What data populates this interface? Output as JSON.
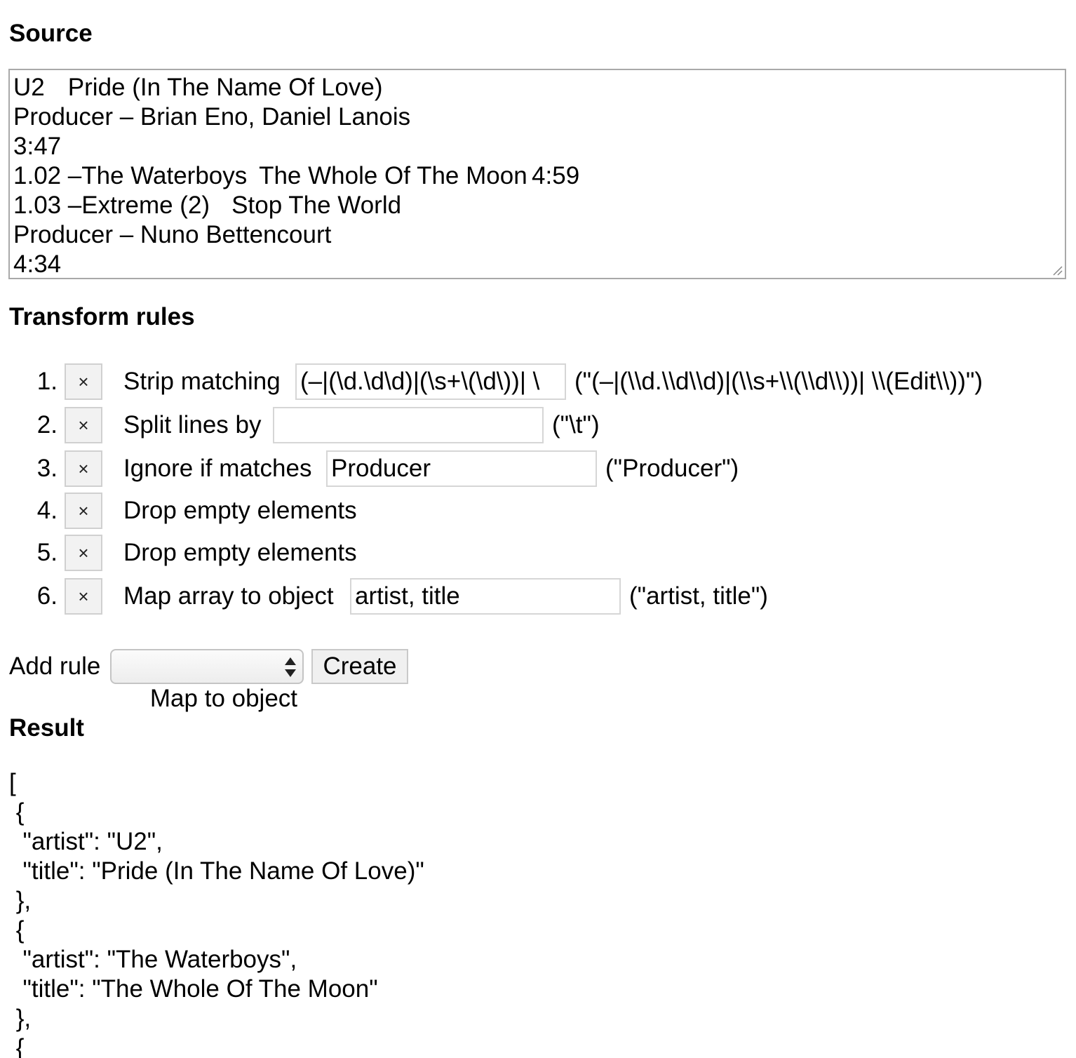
{
  "headings": {
    "source": "Source",
    "rules": "Transform rules",
    "result": "Result"
  },
  "source": {
    "lines": [
      "U2\tPride (In The Name Of Love)",
      "Producer – Brian Eno, Daniel Lanois",
      "3:47",
      "1.02\t–The Waterboys\tThe Whole Of The Moon\t4:59",
      "1.03\t–Extreme (2)\tStop The World",
      "Producer – Nuno Bettencourt",
      "4:34"
    ]
  },
  "rules": [
    {
      "number": "1.",
      "delete_label": "×",
      "label": "Strip matching",
      "input": "(–|(\\d.\\d\\d)|(\\s+\\(\\d\\))| \\",
      "preview": "(\"(–|(\\\\d.\\\\d\\\\d)|(\\\\s+\\\\(\\\\d\\\\))| \\\\(Edit\\\\))\")"
    },
    {
      "number": "2.",
      "delete_label": "×",
      "label": "Split lines by",
      "input": "",
      "preview": "(\"\\t\")"
    },
    {
      "number": "3.",
      "delete_label": "×",
      "label": "Ignore if matches",
      "input": "Producer",
      "preview": "(\"Producer\")"
    },
    {
      "number": "4.",
      "delete_label": "×",
      "label": "Drop empty elements"
    },
    {
      "number": "5.",
      "delete_label": "×",
      "label": "Drop empty elements"
    },
    {
      "number": "6.",
      "delete_label": "×",
      "label": "Map array to object",
      "input": "artist, title",
      "preview": "(\"artist, title\")"
    }
  ],
  "add_rule": {
    "label": "Add rule",
    "selected": "Map to object",
    "create_label": "Create"
  },
  "result": {
    "lines": [
      "[",
      " {",
      "  \"artist\": \"U2\",",
      "  \"title\": \"Pride (In The Name Of Love)\"",
      " },",
      " {",
      "  \"artist\": \"The Waterboys\",",
      "  \"title\": \"The Whole Of The Moon\"",
      " },",
      " {"
    ]
  }
}
